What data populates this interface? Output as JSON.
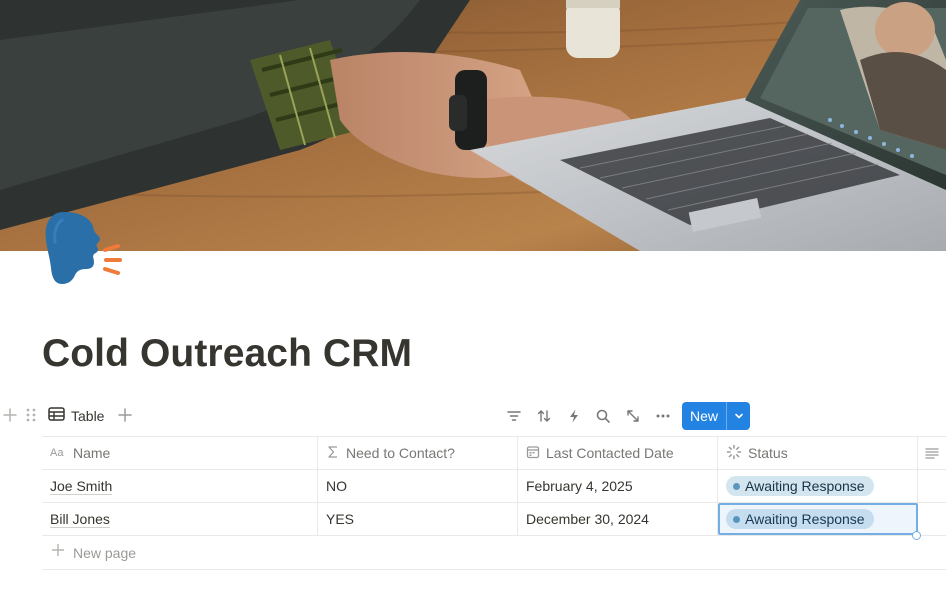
{
  "page": {
    "title": "Cold Outreach CRM",
    "icon": "speaking-head-icon",
    "cover": "cover-photo-laptop-video-call"
  },
  "view": {
    "tab_label": "Table",
    "tab_icon": "table-icon",
    "tools": [
      "filter-icon",
      "sort-icon",
      "automation-icon",
      "search-icon",
      "expand-icon",
      "more-icon"
    ],
    "new_button_label": "New"
  },
  "table": {
    "columns": [
      {
        "label": "Name",
        "icon": "text-property-icon"
      },
      {
        "label": "Need to Contact?",
        "icon": "formula-icon"
      },
      {
        "label": "Last Contacted Date",
        "icon": "calendar-icon"
      },
      {
        "label": "Status",
        "icon": "status-icon"
      }
    ],
    "rows": [
      {
        "name": "Joe Smith",
        "need_to_contact": "NO",
        "last_contacted": "February 4, 2025",
        "status": "Awaiting Response"
      },
      {
        "name": "Bill Jones",
        "need_to_contact": "YES",
        "last_contacted": "December 30, 2024",
        "status": "Awaiting Response"
      }
    ],
    "new_page_label": "New page"
  },
  "colors": {
    "accent": "#2383e2",
    "status_tag_bg": "#d3e5ef",
    "status_tag_dot": "#5b97bd",
    "text": "#37352f",
    "muted": "#787774"
  }
}
